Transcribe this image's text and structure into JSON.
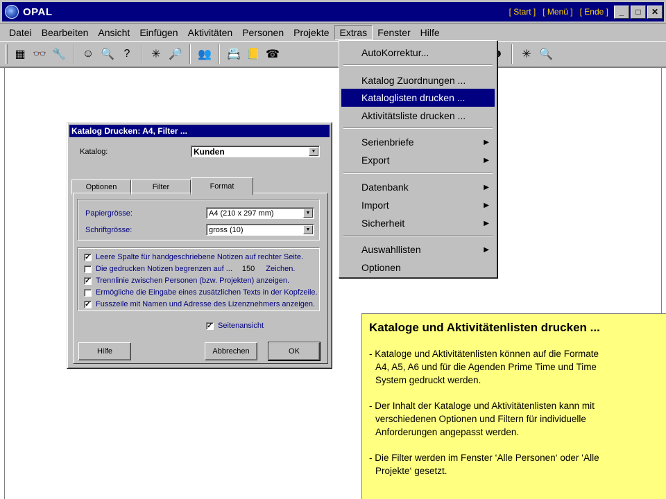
{
  "window": {
    "title": "OPAL",
    "links": [
      "[ Start ]",
      "[ Menü ]",
      "[ Ende ]"
    ],
    "controls": [
      "_",
      "□",
      "✕"
    ]
  },
  "menubar": {
    "items": [
      "Datei",
      "Bearbeiten",
      "Ansicht",
      "Einfügen",
      "Aktivitäten",
      "Personen",
      "Projekte",
      "Extras",
      "Fenster",
      "Hilfe"
    ],
    "active": "Extras"
  },
  "toolbar": {
    "icons": [
      "list-icon",
      "binoculars-icon",
      "tools-icon",
      "smiley-icon",
      "search-person-icon",
      "question-icon",
      "sparkle-smiley-icon",
      "magnify-document-icon",
      "people-icon",
      "address-book-icon",
      "phonebook-icon",
      "phone-icon",
      "network-icon",
      "group-icon",
      "face-icon",
      "new-icon",
      "preview-icon"
    ]
  },
  "extras_menu": {
    "items": [
      {
        "label": "AutoKorrektur...",
        "submenu": false
      },
      {
        "label": "Katalog Zuordnungen ...",
        "submenu": false
      },
      {
        "label": "Kataloglisten drucken ...",
        "submenu": false,
        "highlighted": true
      },
      {
        "label": "Aktivitätsliste drucken ...",
        "submenu": false
      },
      {
        "label": "Serienbriefe",
        "submenu": true
      },
      {
        "label": "Export",
        "submenu": true
      },
      {
        "label": "Datenbank",
        "submenu": true
      },
      {
        "label": "Import",
        "submenu": true
      },
      {
        "label": "Sicherheit",
        "submenu": true
      },
      {
        "label": "Auswahllisten",
        "submenu": true
      },
      {
        "label": "Optionen",
        "submenu": false
      }
    ]
  },
  "dialog": {
    "title": "Katalog Drucken:   A4, Filter ...",
    "catalog_label": "Katalog:",
    "catalog_value": "Kunden",
    "tabs": [
      "Optionen",
      "Filter",
      "Format"
    ],
    "active_tab": "Format",
    "paper_label": "Papiergrösse:",
    "paper_value": "A4 (210 x 297 mm)",
    "font_label": "Schriftgrösse:",
    "font_value": "gross (10)",
    "options": [
      {
        "label": "Leere Spalte für handgeschriebene Notizen auf rechter Seite.",
        "checked": true
      },
      {
        "label": "Die gedrucken Notizen begrenzen auf ...",
        "checked": false,
        "value": "150",
        "suffix": "Zeichen."
      },
      {
        "label": "Trennlinie zwischen Personen (bzw. Projekten) anzeigen.",
        "checked": true
      },
      {
        "label": "Ermögliche die Eingabe eines zusätzlichen Texts in der Kopfzeile.",
        "checked": false
      },
      {
        "label": "Fusszeile mit Namen und Adresse des Lizenznehmers anzeigen.",
        "checked": true
      }
    ],
    "preview_label": "Seitenansicht",
    "preview_checked": true,
    "buttons": {
      "help": "Hilfe",
      "cancel": "Abbrechen",
      "ok": "OK"
    }
  },
  "info": {
    "heading": "Kataloge und Aktivitätenlisten drucken ...",
    "paragraphs": [
      "- Kataloge und Aktivitätenlisten können auf die Formate\nA4, A5, A6 und für die Agenden Prime Time und Time\nSystem gedruckt werden.",
      "- Der Inhalt der Kataloge und Aktivitätenlisten kann mit\nverschiedenen Optionen und Filtern für individuelle\nAnforderungen angepasst werden.",
      "- Die Filter werden im Fenster ‘Alle Personen‘ oder ‘Alle\nProjekte‘ gesetzt."
    ]
  }
}
